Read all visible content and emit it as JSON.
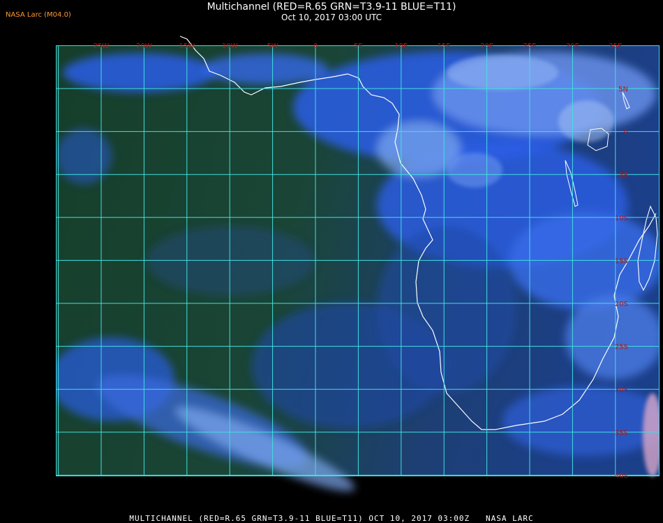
{
  "header": {
    "title": "Multichannel (RED=R.65 GRN=T3.9-11 BLUE=T11)",
    "timestamp": "Oct 10, 2017 03:00 UTC"
  },
  "org_badge": "NASA Larc (M04.0)",
  "footer": {
    "caption": "MULTICHANNEL (RED=R.65 GRN=T3.9-11 BLUE=T11) OCT 10, 2017 03:00Z   NASA LARC"
  },
  "map": {
    "longitude_labels": [
      "25W",
      "20W",
      "15W",
      "10W",
      "5W",
      "0",
      "5E",
      "10E",
      "15E",
      "20E",
      "25E",
      "30E",
      "35E"
    ],
    "latitude_labels": [
      "5N",
      "0",
      "5S",
      "10S",
      "15S",
      "20S",
      "25S",
      "30S",
      "35S",
      "40S"
    ],
    "colors": {
      "background": "#000000",
      "ocean_dark": "#123a24",
      "ocean_blue": "#1c3f8a",
      "cloud_blue": "#2b5ee6",
      "cloud_light": "#7ea8f0",
      "grid_line": "#40e0e0",
      "coastline": "#ffffff",
      "label": "#b01818",
      "header_text": "#ffffff",
      "badge_text": "#ff9933"
    }
  }
}
